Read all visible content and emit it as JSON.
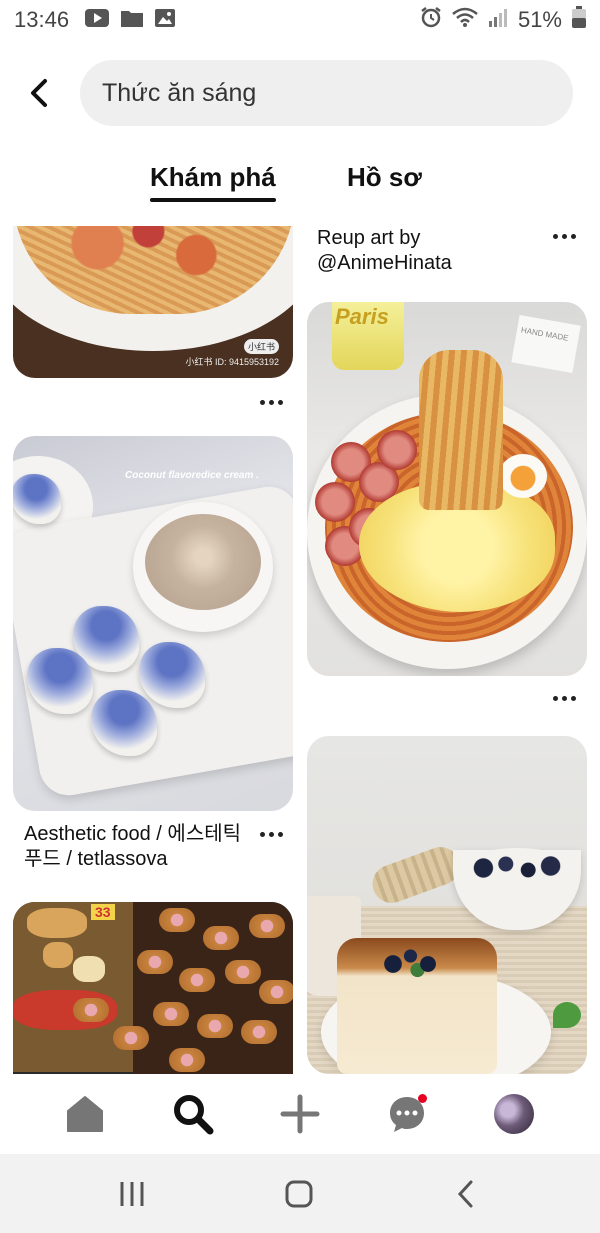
{
  "status_bar": {
    "time": "13:46",
    "battery": "51%",
    "icons": [
      "youtube-icon",
      "folder-icon",
      "image-icon",
      "alarm-icon",
      "wifi-icon",
      "signal-icon",
      "battery-icon"
    ]
  },
  "search": {
    "query": "Thức ăn sáng"
  },
  "tabs": [
    {
      "label": "Khám phá",
      "active": true
    },
    {
      "label": "Hồ sơ",
      "active": false
    }
  ],
  "pins": {
    "pasta": {
      "watermark": "小红书 ID: 9415953192",
      "badge": "小红书"
    },
    "ice_cream": {
      "caption": "Coconut flavoredice cream .",
      "title": "Aesthetic food / 에스테틱 푸드 / tetlassova"
    },
    "sausages": {
      "tag": "33"
    },
    "noodles": {
      "title": "Reup art by @AnimeHinata",
      "glass_label": "Paris",
      "card_text": "HAND MADE"
    },
    "pancake": {}
  },
  "bottom_nav": {
    "items": [
      "home-icon",
      "search-icon",
      "plus-icon",
      "messages-icon",
      "profile-avatar"
    ],
    "has_notification": true
  },
  "colors": {
    "accent": "#e60023",
    "search_bg": "#efefef",
    "text": "#111111"
  }
}
